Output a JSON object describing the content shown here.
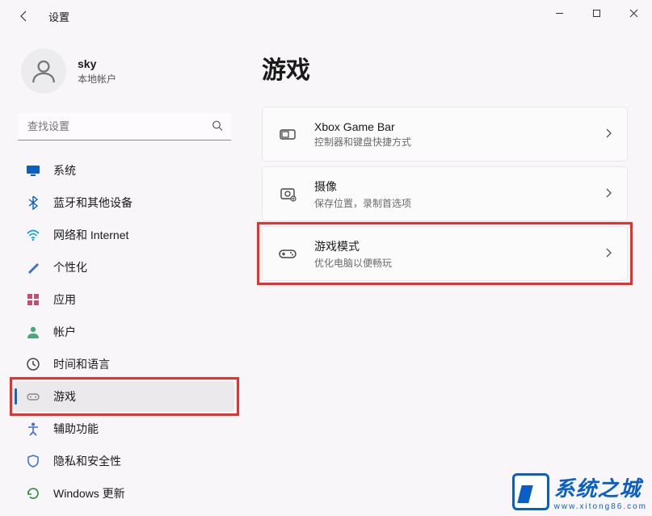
{
  "window": {
    "title": "设置"
  },
  "profile": {
    "name": "sky",
    "type": "本地帐户"
  },
  "search": {
    "placeholder": "查找设置"
  },
  "nav": {
    "items": [
      {
        "id": "system",
        "label": "系统",
        "icon": "monitor",
        "color": "#0a5fc6"
      },
      {
        "id": "bluetooth",
        "label": "蓝牙和其他设备",
        "icon": "bluetooth",
        "color": "#0a5fc6"
      },
      {
        "id": "network",
        "label": "网络和 Internet",
        "icon": "wifi",
        "color": "#00a3e0"
      },
      {
        "id": "personalization",
        "label": "个性化",
        "icon": "brush",
        "color": "#3c6ed6"
      },
      {
        "id": "apps",
        "label": "应用",
        "icon": "apps",
        "color": "#c1506f"
      },
      {
        "id": "accounts",
        "label": "帐户",
        "icon": "person",
        "color": "#4aa77a"
      },
      {
        "id": "time",
        "label": "时间和语言",
        "icon": "clock",
        "color": "#444"
      },
      {
        "id": "gaming",
        "label": "游戏",
        "icon": "gamepad",
        "color": "#888",
        "selected": true
      },
      {
        "id": "accessibility",
        "label": "辅助功能",
        "icon": "accessibility",
        "color": "#3c6ed6"
      },
      {
        "id": "privacy",
        "label": "隐私和安全性",
        "icon": "shield",
        "color": "#3c6ed6"
      },
      {
        "id": "update",
        "label": "Windows 更新",
        "icon": "update",
        "color": "#2c8a3a"
      }
    ]
  },
  "main": {
    "title": "游戏",
    "cards": [
      {
        "id": "xbox",
        "title": "Xbox Game Bar",
        "sub": "控制器和键盘快捷方式"
      },
      {
        "id": "capture",
        "title": "摄像",
        "sub": "保存位置，录制首选项"
      },
      {
        "id": "gamemode",
        "title": "游戏模式",
        "sub": "优化电脑以便畅玩",
        "highlighted": true
      }
    ]
  },
  "watermark": {
    "big": "系统之城",
    "url": "www.xitong86.com"
  }
}
